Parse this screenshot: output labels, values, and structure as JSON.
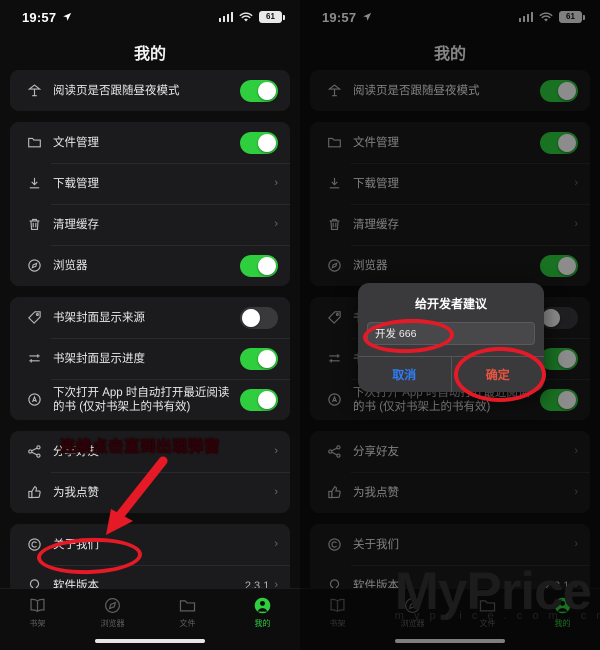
{
  "status_bar": {
    "time": "19:57",
    "battery": "61",
    "location_icon": "location-arrow-icon",
    "wifi_icon": "wifi-icon",
    "signal_icon": "cellular-signal-icon"
  },
  "nav": {
    "title": "我的"
  },
  "groups": [
    {
      "rows": [
        {
          "icon": "lamp-icon",
          "label": "阅读页是否跟随昼夜模式",
          "control": "toggle",
          "state": "on"
        }
      ]
    },
    {
      "rows": [
        {
          "icon": "folder-icon",
          "label": "文件管理",
          "control": "toggle",
          "state": "on"
        },
        {
          "icon": "download-icon",
          "label": "下载管理",
          "control": "chevron",
          "chevron": "›"
        },
        {
          "icon": "trash-icon",
          "label": "清理缓存",
          "control": "chevron",
          "chevron": "›"
        },
        {
          "icon": "compass-icon",
          "label": "浏览器",
          "control": "toggle",
          "state": "on"
        }
      ]
    },
    {
      "rows": [
        {
          "icon": "tag-icon",
          "label": "书架封面显示来源",
          "control": "toggle",
          "state": "off"
        },
        {
          "icon": "progress-icon",
          "label": "书架封面显示进度",
          "control": "toggle",
          "state": "on"
        },
        {
          "icon": "circle-a-icon",
          "label": "下次打开 App 时自动打开最近阅读的书 (仅对书架上的书有效)",
          "control": "toggle",
          "state": "on"
        }
      ]
    },
    {
      "rows": [
        {
          "icon": "share-icon",
          "label": "分享好友",
          "control": "chevron",
          "chevron": "›"
        },
        {
          "icon": "thumbs-up-icon",
          "label": "为我点赞",
          "control": "chevron",
          "chevron": "›"
        }
      ]
    },
    {
      "rows": [
        {
          "icon": "copyright-icon",
          "label": "关于我们",
          "control": "chevron",
          "chevron": "›"
        },
        {
          "icon": "bulb-icon",
          "label": "软件版本",
          "control": "value-chevron",
          "value": "2.3.1",
          "chevron": "›"
        }
      ]
    }
  ],
  "tabbar": {
    "items": [
      {
        "icon": "book-icon",
        "label": "书架",
        "active": false
      },
      {
        "icon": "compass-icon",
        "label": "浏览器",
        "active": false
      },
      {
        "icon": "folder-icon",
        "label": "文件",
        "active": false
      },
      {
        "icon": "person-icon",
        "label": "我的",
        "active": true
      }
    ]
  },
  "dialog": {
    "title": "给开发者建议",
    "input_value": "开发 666",
    "input_placeholder": "",
    "cancel_label": "取消",
    "confirm_label": "确定"
  },
  "annotations": {
    "instruction": "连续点击直到出现弹窗",
    "arrow": "red-arrow-pointing-to-software-version",
    "highlight_color": "#e61a26",
    "text_color": "#e8203a"
  },
  "watermark": {
    "main": "MyPrice",
    "sub": "m y p r i c e . c o m . c n"
  }
}
